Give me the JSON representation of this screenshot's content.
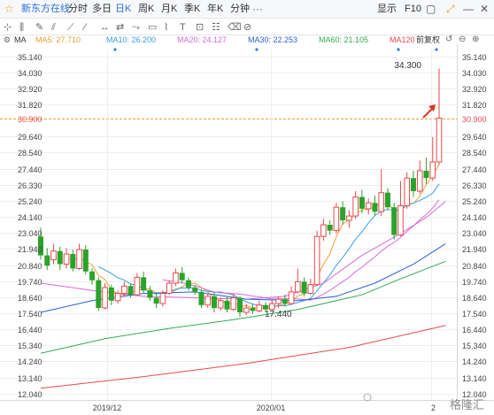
{
  "toolbar": {
    "name": "新东方在线",
    "periods": [
      "分时",
      "多日",
      "日K",
      "周K",
      "月K",
      "季K",
      "年K",
      "分钟"
    ],
    "active_period": "日K",
    "display_label": "显示",
    "f10_label": "F10"
  },
  "ma_bar": {
    "indicator": "MA",
    "items": [
      {
        "label": "MA5: 27.710",
        "color": "#f0a030"
      },
      {
        "label": "MA10: 26.200",
        "color": "#3a9de6"
      },
      {
        "label": "MA20: 24.127",
        "color": "#d96ad9"
      },
      {
        "label": "MA30: 22.253",
        "color": "#2a5fd8"
      },
      {
        "label": "MA60: 21.105",
        "color": "#33aa55"
      },
      {
        "label": "MA120",
        "color": "#e84a4a"
      }
    ],
    "adjust_label": "前复权"
  },
  "colors": {
    "up": "#e84a4a",
    "down": "#2aa32a",
    "grid": "#eceef1",
    "axis_text": "#444444",
    "accent": "#2a6fd8"
  },
  "chart_data": {
    "type": "candlestick",
    "y_ticks": [
      "35.140",
      "34.030",
      "32.920",
      "31.820",
      "30.900",
      "29.640",
      "28.540",
      "27.440",
      "26.330",
      "25.240",
      "24.140",
      "23.040",
      "21.940",
      "20.840",
      "19.740",
      "18.640",
      "17.540",
      "16.440",
      "15.340",
      "14.240",
      "13.140",
      "12.040"
    ],
    "ylim": [
      11.6,
      35.6
    ],
    "current_price": "30.900",
    "x_labels": [
      "2019/12",
      "2020/01",
      "2"
    ],
    "annotations": {
      "high": "34.300",
      "low": "17.440"
    },
    "candles": [
      [
        22.8,
        21.5,
        23.4,
        21.2
      ],
      [
        21.5,
        20.8,
        22.0,
        20.5
      ],
      [
        21.2,
        21.8,
        22.3,
        20.9
      ],
      [
        21.8,
        20.9,
        22.1,
        20.5
      ],
      [
        20.9,
        21.6,
        22.0,
        20.6
      ],
      [
        21.6,
        20.6,
        21.9,
        20.4
      ],
      [
        20.6,
        21.9,
        22.3,
        20.5
      ],
      [
        21.9,
        20.4,
        22.2,
        20.2
      ],
      [
        20.4,
        19.8,
        20.6,
        19.5
      ],
      [
        19.8,
        17.9,
        20.0,
        17.7
      ],
      [
        17.9,
        19.3,
        19.6,
        17.8
      ],
      [
        19.3,
        18.4,
        19.5,
        18.1
      ],
      [
        18.4,
        18.9,
        19.1,
        18.2
      ],
      [
        18.9,
        19.4,
        19.7,
        18.7
      ],
      [
        19.4,
        18.8,
        19.6,
        18.6
      ],
      [
        18.8,
        20.0,
        20.3,
        18.7
      ],
      [
        20.0,
        19.1,
        20.4,
        18.9
      ],
      [
        19.1,
        18.6,
        19.4,
        18.4
      ],
      [
        18.6,
        18.2,
        18.9,
        17.9
      ],
      [
        18.2,
        18.9,
        19.1,
        18.0
      ],
      [
        18.9,
        19.6,
        19.8,
        18.8
      ],
      [
        19.6,
        20.3,
        20.6,
        19.4
      ],
      [
        20.3,
        19.8,
        20.7,
        19.6
      ],
      [
        19.8,
        19.3,
        20.0,
        19.1
      ],
      [
        19.3,
        19.0,
        19.5,
        18.8
      ],
      [
        19.0,
        18.1,
        19.2,
        17.9
      ],
      [
        18.1,
        18.7,
        18.9,
        17.9
      ],
      [
        18.7,
        17.9,
        19.0,
        17.6
      ],
      [
        17.9,
        18.4,
        18.6,
        17.7
      ],
      [
        18.4,
        17.8,
        18.7,
        17.6
      ],
      [
        17.8,
        18.6,
        18.9,
        17.7
      ],
      [
        18.6,
        17.6,
        18.7,
        17.3
      ],
      [
        17.6,
        17.9,
        18.2,
        17.4
      ],
      [
        17.9,
        17.7,
        18.2,
        17.5
      ],
      [
        17.7,
        18.1,
        18.4,
        17.6
      ],
      [
        18.1,
        17.8,
        18.3,
        17.6
      ],
      [
        17.8,
        18.2,
        18.4,
        17.7
      ],
      [
        18.2,
        18.5,
        18.7,
        17.9
      ],
      [
        18.5,
        18.2,
        18.8,
        18.0
      ],
      [
        18.2,
        19.0,
        19.4,
        18.1
      ],
      [
        19.0,
        19.7,
        20.6,
        18.9
      ],
      [
        19.7,
        18.9,
        20.0,
        18.7
      ],
      [
        18.9,
        19.5,
        19.9,
        18.8
      ],
      [
        19.5,
        22.8,
        23.2,
        19.4
      ],
      [
        22.8,
        23.6,
        24.0,
        22.5
      ],
      [
        23.6,
        23.2,
        23.9,
        22.9
      ],
      [
        23.2,
        24.8,
        25.1,
        23.0
      ],
      [
        24.8,
        23.9,
        25.2,
        23.6
      ],
      [
        23.9,
        24.2,
        24.6,
        23.4
      ],
      [
        24.2,
        25.5,
        25.9,
        24.0
      ],
      [
        25.5,
        24.7,
        26.0,
        24.4
      ],
      [
        24.7,
        25.1,
        25.4,
        24.3
      ],
      [
        25.1,
        24.5,
        25.6,
        24.2
      ],
      [
        24.5,
        25.8,
        27.4,
        24.2
      ],
      [
        25.8,
        24.8,
        26.1,
        24.6
      ],
      [
        24.8,
        22.9,
        25.1,
        22.6
      ],
      [
        22.9,
        24.9,
        26.6,
        22.8
      ],
      [
        24.9,
        26.8,
        27.2,
        24.7
      ],
      [
        26.8,
        25.9,
        27.3,
        25.5
      ],
      [
        25.9,
        27.3,
        28.0,
        25.7
      ],
      [
        27.3,
        26.8,
        28.2,
        26.4
      ],
      [
        26.8,
        27.9,
        29.6,
        26.6
      ],
      [
        27.9,
        30.9,
        34.3,
        27.7
      ]
    ],
    "ma_series_colors": {
      "MA5": "#f0a030",
      "MA10": "#3a9de6",
      "MA20": "#d96ad9",
      "MA30": "#2a5fd8",
      "MA60": "#33aa55",
      "MA120": "#e84a4a"
    }
  },
  "watermark": "格隆汇"
}
